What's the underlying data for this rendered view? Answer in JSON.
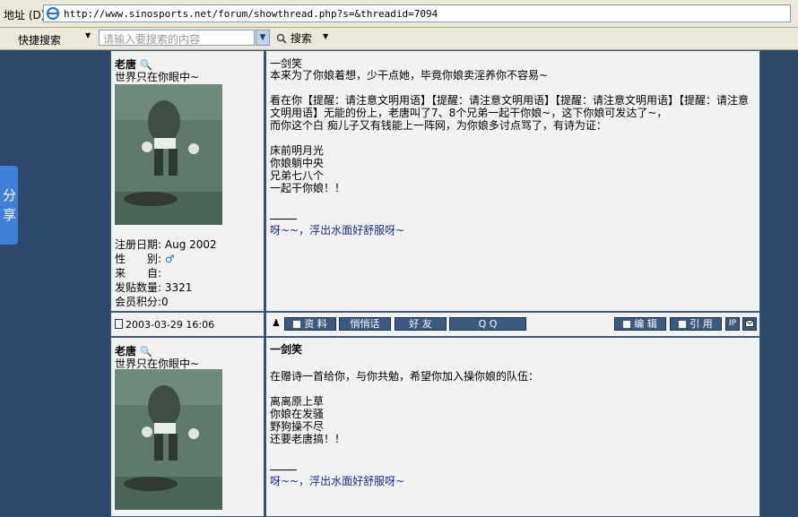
{
  "browser": {
    "address_label": "地址 (D)",
    "url": "http://www.sinosports.net/forum/showthread.php?s=&threadid=7094",
    "quick_search_label": "快捷搜索",
    "search_placeholder": "请输入要搜索的内容",
    "search_button": "搜索",
    "share_label": "分享"
  },
  "posts": [
    {
      "author": "老唐",
      "user_title": "世界只在你眼中~",
      "register_label": "注册日期:",
      "register_date": "Aug 2002",
      "gender_label": "性　　别:",
      "from_label": "来　　自:",
      "post_count_label": "发贴数量:",
      "post_count": "3321",
      "points_label": "会员积分:",
      "points": "0",
      "title": "一剑笑",
      "body": [
        "本来为了你娘着想，少干点她，毕竟你娘卖淫养你不容易~",
        "",
        "看在你【提醒：请注意文明用语】【提醒：请注意文明用语】【提醒：请注意文明用语】【提醒：请注意",
        "文明用语】无能的份上，老唐叫了7、8个兄弟一起干你娘~，这下你娘可发达了~，",
        "而你这个白 痴儿子又有钱能上一阵网，为你娘多讨点骂了，有诗为证：",
        "",
        "床前明月光",
        "你娘躺中央",
        "兄弟七八个",
        "一起干你娘！！"
      ],
      "signature": "呀~~，浮出水面好舒服呀~",
      "date": "2003-03-29 16:06"
    },
    {
      "author": "老唐",
      "user_title": "世界只在你眼中~",
      "title": "一剑笑",
      "body": [
        "在赠诗一首给你，与你共勉，希望你加入操你娘的队伍：",
        "",
        "离离原上草",
        "你娘在发骚",
        "野狗操不尽",
        "还要老唐搞！！"
      ],
      "signature": "呀~~，浮出水面好舒服呀~"
    }
  ],
  "buttons": {
    "profile": "资 料",
    "pm": "悄悄话",
    "friend": "好 友",
    "qq": "Q Q",
    "edit": "编 辑",
    "quote": "引 用",
    "ip": "IP"
  }
}
